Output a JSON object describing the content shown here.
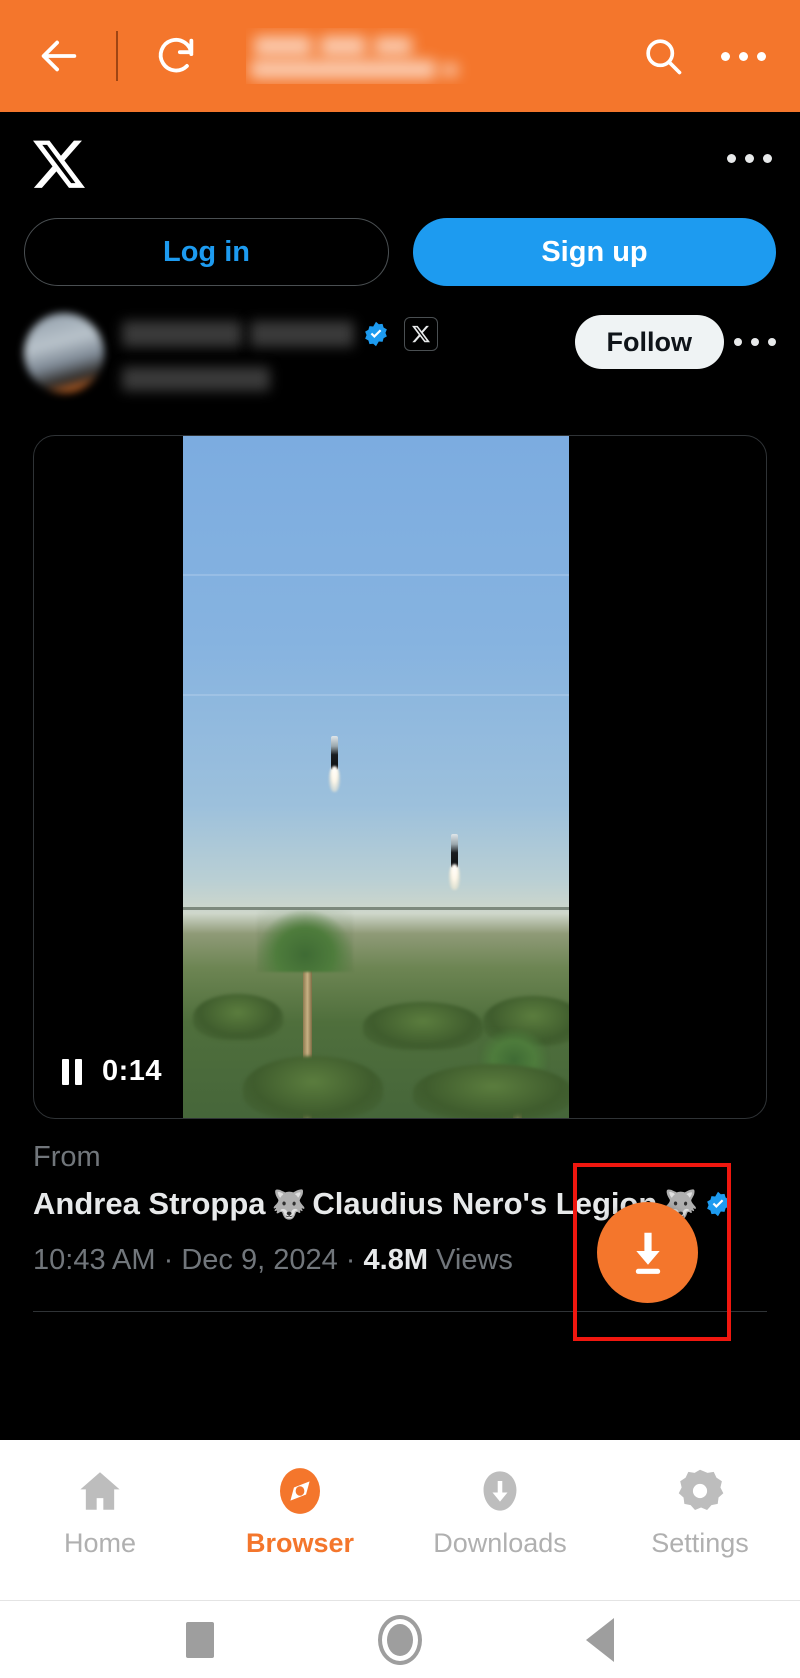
{
  "browser_bar": {
    "back_icon": "back-arrow-icon",
    "reload_icon": "reload-icon",
    "url_value": "",
    "url_placeholder": "",
    "search_icon": "search-icon",
    "overflow_icon": "overflow-menu-icon",
    "background_color": "#F4762C"
  },
  "x_page": {
    "logo": "x-logo-icon",
    "overflow_icon": "overflow-menu-icon",
    "login_label": "Log in",
    "signup_label": "Sign up",
    "accent_blue": "#1D9BF0",
    "profile": {
      "display_name": "",
      "handle": "",
      "verified": true,
      "x_badge": "x-badge-icon",
      "follow_label": "Follow",
      "overflow_icon": "overflow-menu-icon"
    }
  },
  "video": {
    "pause_icon": "pause-icon",
    "timestamp": "0:14"
  },
  "tweet": {
    "from_label": "From",
    "author_part1": "Andrea Stroppa",
    "author_emoji1": "🐺",
    "author_part2": "Claudius Nero's Legion",
    "author_emoji2": "🐺",
    "verified_icon": "verified-badge-icon",
    "time": "10:43 AM",
    "separator": "·",
    "date": "Dec 9, 2024",
    "views_count": "4.8M",
    "views_label": "Views"
  },
  "download_fab": {
    "icon": "download-icon",
    "color": "#F4762C",
    "highlight_color": "#F0170F"
  },
  "bottom_nav": {
    "items": [
      {
        "label": "Home",
        "icon": "home-icon",
        "active": false
      },
      {
        "label": "Browser",
        "icon": "compass-icon",
        "active": true
      },
      {
        "label": "Downloads",
        "icon": "download-cloud-icon",
        "active": false
      },
      {
        "label": "Settings",
        "icon": "gear-icon",
        "active": false
      }
    ]
  },
  "system_nav": {
    "recents_icon": "square-recents-icon",
    "home_icon": "circle-home-icon",
    "back_icon": "triangle-back-icon"
  }
}
